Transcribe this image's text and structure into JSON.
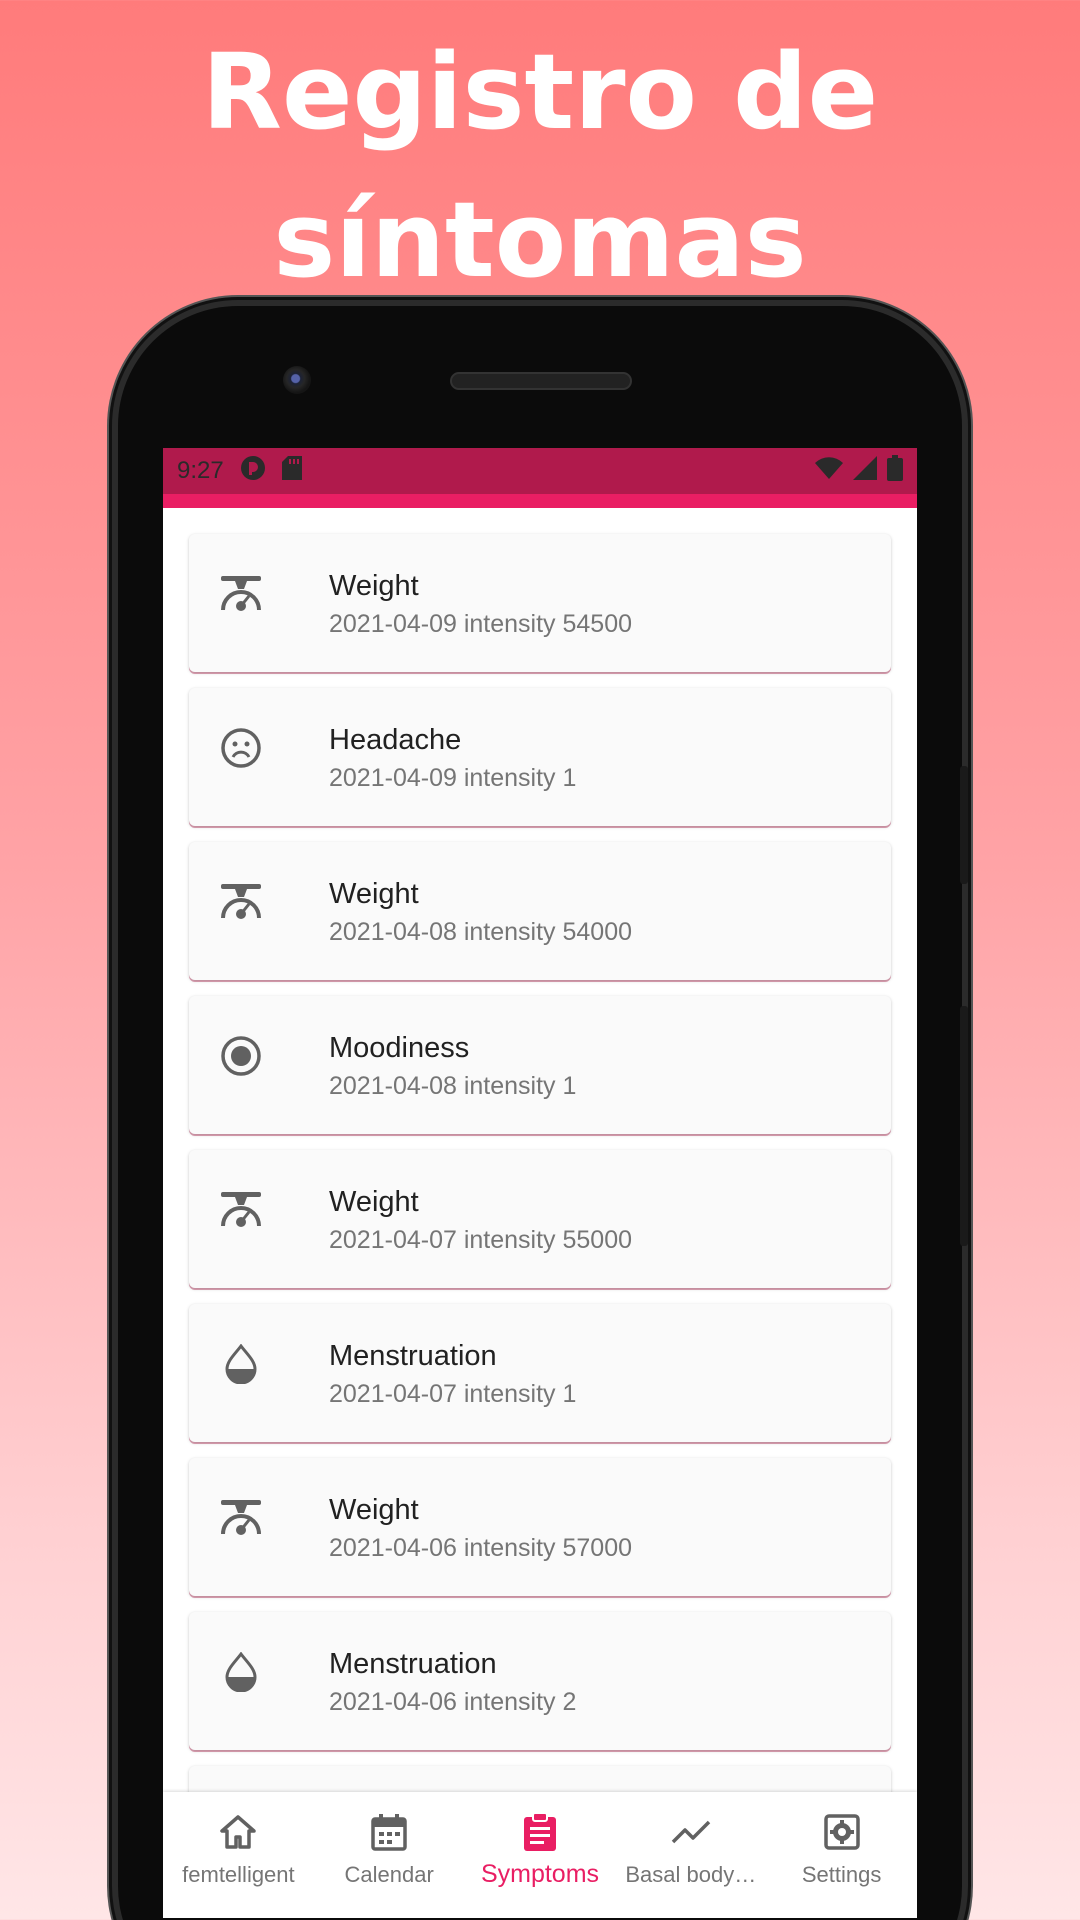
{
  "promo": {
    "title_line1": "Registro de",
    "title_line2": "síntomas"
  },
  "status_bar": {
    "time": "9:27",
    "left_icons": [
      "app-notification-icon",
      "sd-card-icon"
    ],
    "right_icons": [
      "wifi-icon",
      "signal-icon",
      "battery-icon"
    ]
  },
  "entries": [
    {
      "title": "Weight",
      "subtitle": "2021-04-09 intensity 54500",
      "icon": "scale-icon"
    },
    {
      "title": "Headache",
      "subtitle": "2021-04-09 intensity 1",
      "icon": "sad-face-icon"
    },
    {
      "title": "Weight",
      "subtitle": "2021-04-08 intensity 54000",
      "icon": "scale-icon"
    },
    {
      "title": "Moodiness",
      "subtitle": "2021-04-08 intensity 1",
      "icon": "radio-target-icon"
    },
    {
      "title": "Weight",
      "subtitle": "2021-04-07 intensity 55000",
      "icon": "scale-icon"
    },
    {
      "title": "Menstruation",
      "subtitle": "2021-04-07 intensity 1",
      "icon": "drop-icon"
    },
    {
      "title": "Weight",
      "subtitle": "2021-04-06 intensity 57000",
      "icon": "scale-icon"
    },
    {
      "title": "Menstruation",
      "subtitle": "2021-04-06 intensity 2",
      "icon": "drop-icon"
    }
  ],
  "bottom_nav": {
    "items": [
      {
        "label": "femtelligent",
        "icon": "home-icon"
      },
      {
        "label": "Calendar",
        "icon": "calendar-icon"
      },
      {
        "label": "Symptoms",
        "icon": "clipboard-icon",
        "active": true
      },
      {
        "label": "Basal body…",
        "icon": "trend-icon"
      },
      {
        "label": "Settings",
        "icon": "settings-icon"
      }
    ]
  },
  "colors": {
    "accent": "#e91e63",
    "status_bar": "#b01a4c",
    "text_primary": "#212121",
    "text_secondary": "#757575"
  }
}
